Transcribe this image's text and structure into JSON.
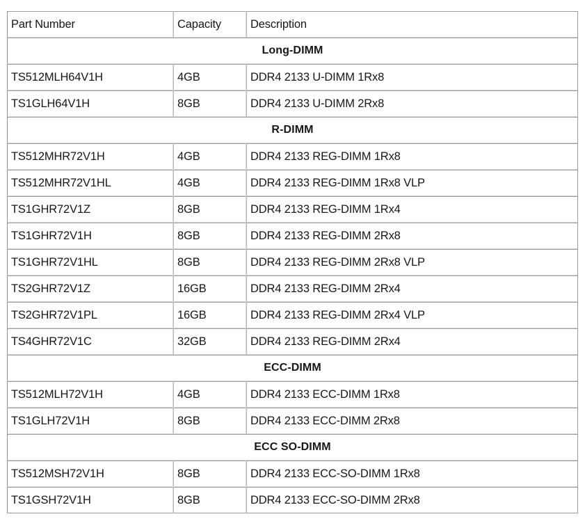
{
  "table": {
    "columns": [
      {
        "key": "part_number",
        "label": "Part Number"
      },
      {
        "key": "capacity",
        "label": "Capacity"
      },
      {
        "key": "description",
        "label": "Description"
      }
    ],
    "sections": [
      {
        "title": "Long-DIMM",
        "rows": [
          {
            "part_number": "TS512MLH64V1H",
            "capacity": "4GB",
            "description": "DDR4 2133 U-DIMM 1Rx8"
          },
          {
            "part_number": "TS1GLH64V1H",
            "capacity": "8GB",
            "description": "DDR4 2133 U-DIMM 2Rx8"
          }
        ]
      },
      {
        "title": "R-DIMM",
        "rows": [
          {
            "part_number": "TS512MHR72V1H",
            "capacity": "4GB",
            "description": "DDR4 2133 REG-DIMM 1Rx8"
          },
          {
            "part_number": "TS512MHR72V1HL",
            "capacity": "4GB",
            "description": "DDR4 2133 REG-DIMM 1Rx8 VLP"
          },
          {
            "part_number": "TS1GHR72V1Z",
            "capacity": "8GB",
            "description": "DDR4 2133 REG-DIMM 1Rx4"
          },
          {
            "part_number": "TS1GHR72V1H",
            "capacity": "8GB",
            "description": "DDR4 2133 REG-DIMM 2Rx8"
          },
          {
            "part_number": "TS1GHR72V1HL",
            "capacity": "8GB",
            "description": "DDR4 2133 REG-DIMM 2Rx8 VLP"
          },
          {
            "part_number": "TS2GHR72V1Z",
            "capacity": "16GB",
            "description": "DDR4 2133 REG-DIMM 2Rx4"
          },
          {
            "part_number": "TS2GHR72V1PL",
            "capacity": "16GB",
            "description": "DDR4 2133 REG-DIMM 2Rx4 VLP"
          },
          {
            "part_number": "TS4GHR72V1C",
            "capacity": "32GB",
            "description": "DDR4 2133 REG-DIMM 2Rx4"
          }
        ]
      },
      {
        "title": "ECC-DIMM",
        "rows": [
          {
            "part_number": "TS512MLH72V1H",
            "capacity": "4GB",
            "description": "DDR4 2133 ECC-DIMM 1Rx8"
          },
          {
            "part_number": "TS1GLH72V1H",
            "capacity": "8GB",
            "description": "DDR4 2133 ECC-DIMM 2Rx8"
          }
        ]
      },
      {
        "title": "ECC SO-DIMM",
        "rows": [
          {
            "part_number": "TS512MSH72V1H",
            "capacity": "8GB",
            "description": "DDR4 2133 ECC-SO-DIMM 1Rx8"
          },
          {
            "part_number": "TS1GSH72V1H",
            "capacity": "8GB",
            "description": "DDR4 2133 ECC-SO-DIMM 2Rx8"
          }
        ]
      }
    ]
  },
  "style": {
    "border_color": "#9a9a9a",
    "border_color_light": "#d8d8d8",
    "text_color": "#171717",
    "background": "#ffffff"
  }
}
